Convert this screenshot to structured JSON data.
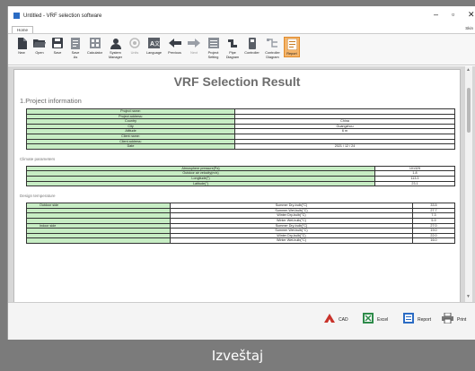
{
  "window": {
    "title": "Untitled - VRF selection software"
  },
  "ribbon": {
    "tab": "Home",
    "right_label": "Skin",
    "tools": [
      {
        "label": "New",
        "icon": "new-file-icon"
      },
      {
        "label": "Open",
        "icon": "open-folder-icon"
      },
      {
        "label": "Save",
        "icon": "save-icon"
      },
      {
        "label": "Save\nAs",
        "icon": "save-as-icon"
      },
      {
        "label": "Calculator",
        "icon": "calculator-icon"
      },
      {
        "label": "System\nManager",
        "icon": "system-manager-icon"
      },
      {
        "label": "Units",
        "icon": "units-icon"
      },
      {
        "label": "Language",
        "icon": "language-icon"
      },
      {
        "label": "Previous",
        "icon": "arrow-left-icon"
      },
      {
        "label": "Next",
        "icon": "arrow-right-icon"
      },
      {
        "label": "Project\nSetting",
        "icon": "project-setting-icon"
      },
      {
        "label": "Pipe\nDiagram",
        "icon": "pipe-diagram-icon"
      },
      {
        "label": "Controller",
        "icon": "controller-icon"
      },
      {
        "label": "Controller\nDiagram",
        "icon": "controller-diagram-icon"
      },
      {
        "label": "Report",
        "icon": "report-icon"
      }
    ]
  },
  "document": {
    "title": "VRF Selection Result",
    "section1": "1.Project information",
    "project_rows": [
      [
        "Project name:",
        ""
      ],
      [
        "Project address:",
        ""
      ],
      [
        "Country",
        "China"
      ],
      [
        "City",
        "Guangzhou"
      ],
      [
        "Altitude",
        "6 m"
      ],
      [
        "Client name:",
        ""
      ],
      [
        "Client address:",
        ""
      ],
      [
        "Date",
        "2021 / 12 / 24"
      ]
    ],
    "climate_heading": "Climate parameters",
    "climate_rows": [
      [
        "Atmosphere pressure(Pa)",
        "101325"
      ],
      [
        "Outdoor air velocity(m/s)",
        "1.8"
      ],
      [
        "Longitude(°)",
        "113.3"
      ],
      [
        "Latitude(°)",
        "23.1"
      ]
    ],
    "design_heading": "Design temperature",
    "design_rows": [
      [
        "Outdoor side",
        "Summer Dry-bulb(°C)",
        "33.5"
      ],
      [
        "",
        "Summer Wet-bulb(°C)",
        "27.7"
      ],
      [
        "",
        "Winter Dry-bulb(°C)",
        "7.3"
      ],
      [
        "",
        "Winter Wet-bulb(°C)",
        "5.9"
      ],
      [
        "Indoor side",
        "Summer Dry-bulb(°C)",
        "27.0"
      ],
      [
        "",
        "Summer Wet-bulb(°C)",
        "19.0"
      ],
      [
        "",
        "Winter Dry-bulb(°C)",
        "22.0"
      ],
      [
        "",
        "Winter Wet-bulb(°C)",
        "16.0"
      ]
    ]
  },
  "export": {
    "cad": "CAD",
    "excel": "Excel",
    "report": "Report",
    "print": "Print"
  },
  "caption": "Izveštaj",
  "colors": {
    "table_green": "#c7edc4",
    "report_active": "#f4b46a",
    "title_gray": "#6d6d6d"
  }
}
